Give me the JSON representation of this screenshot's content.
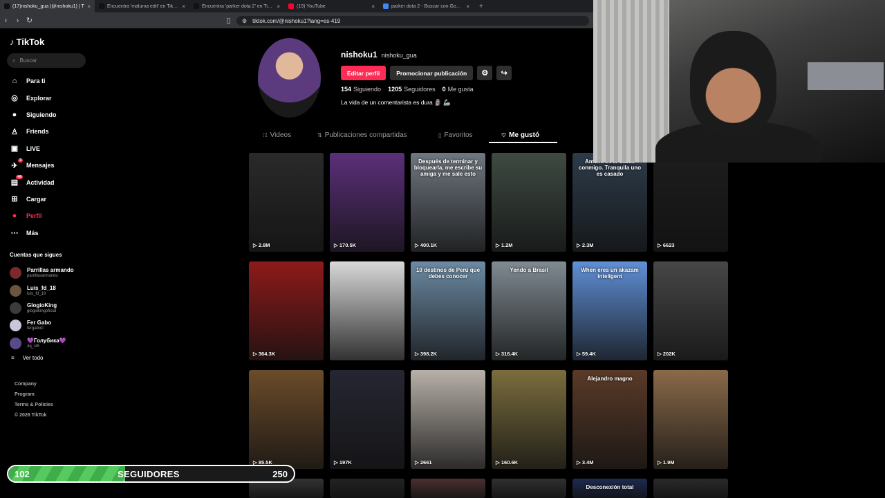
{
  "browser": {
    "tabs": [
      {
        "title": "(17)nishoku_gua (@nishoku1) | T",
        "active": true,
        "favicon_color": "#111111"
      },
      {
        "title": "Encuentra 'maluma edit' en TikTok | I",
        "active": false,
        "favicon_color": "#111111"
      },
      {
        "title": "Encuentra 'parker dota 2' en TikTok | I",
        "active": false,
        "favicon_color": "#111111"
      },
      {
        "title": "(19) YouTube",
        "active": false,
        "favicon_color": "#ff0033"
      },
      {
        "title": "parker dota 2 - Buscar con Google",
        "active": false,
        "favicon_color": "#4285f4"
      }
    ],
    "url": "tiktok.com/@nishoku1?lang=es-419"
  },
  "sidebar": {
    "brand": "TikTok",
    "search_placeholder": "Buscar",
    "nav": [
      {
        "label": "Para ti",
        "icon": "home-icon",
        "glyph": "⌂"
      },
      {
        "label": "Explorar",
        "icon": "compass-icon",
        "glyph": "◎"
      },
      {
        "label": "Siguiendo",
        "icon": "following-icon",
        "glyph": "●"
      },
      {
        "label": "Friends",
        "icon": "friends-icon",
        "glyph": "♙"
      },
      {
        "label": "LIVE",
        "icon": "live-icon",
        "glyph": "▣"
      },
      {
        "label": "Mensajes",
        "icon": "messages-icon",
        "glyph": "✈",
        "badge": "3"
      },
      {
        "label": "Actividad",
        "icon": "activity-icon",
        "glyph": "▤",
        "badge": "44"
      },
      {
        "label": "Cargar",
        "icon": "upload-icon",
        "glyph": "⊞"
      },
      {
        "label": "Perfil",
        "icon": "profile-icon",
        "glyph": "●",
        "active": true
      },
      {
        "label": "Más",
        "icon": "more-icon",
        "glyph": "⋯"
      }
    ],
    "following_heading": "Cuentas que sigues",
    "following": [
      {
        "name": "Parrillas armando",
        "handle": "parrillasarmando",
        "color": "#7a2a2a"
      },
      {
        "name": "Luis_fd_18",
        "handle": "luis_fd_18",
        "color": "#6b5440"
      },
      {
        "name": "GlogioKing",
        "handle": "glogiokingoficial",
        "color": "#3b3b3b"
      },
      {
        "name": "Fer Gabo",
        "handle": "fergabo0",
        "color": "#c7c7d9"
      },
      {
        "name": "💜Голубика💜",
        "handle": "4q_st5",
        "color": "#5a4a8a"
      }
    ],
    "see_all": "Ver todo",
    "footer": [
      "Company",
      "Program",
      "Terms & Policies",
      "© 2026 TikTok"
    ]
  },
  "profile": {
    "username": "nishoku1",
    "nickname": "nishoku_gua",
    "edit_button": "Editar perfil",
    "promote_button": "Promocionar publicación",
    "following_count": "154",
    "following_label": "Siguiendo",
    "followers_count": "1205",
    "followers_label": "Seguidores",
    "likes_count": "0",
    "likes_label": "Me gusta",
    "bio": "La vida de un comentarista es dura 🗿 🦾"
  },
  "tabs": [
    {
      "label": "Videos",
      "icon": "grid-icon",
      "glyph": "⁞⁞⁞"
    },
    {
      "label": "Publicaciones compartidas",
      "icon": "repost-icon",
      "glyph": "⇅"
    },
    {
      "label": "Favoritos",
      "icon": "bookmark-icon",
      "glyph": "▯"
    },
    {
      "label": "Me gustó",
      "icon": "heart-icon",
      "glyph": "♡",
      "active": true
    }
  ],
  "videos": [
    {
      "views": "2.8M",
      "caption": "",
      "bg": "#2a2a2a"
    },
    {
      "views": "170.5K",
      "caption": "",
      "bg": "#5b2f7a"
    },
    {
      "views": "400.1K",
      "caption": "Después de terminar y bloquearla, me escribe su amiga y me sale esto",
      "bg": "#6f7780"
    },
    {
      "views": "1.2M",
      "caption": "",
      "bg": "#3e4a42"
    },
    {
      "views": "2.3M",
      "caption": "Amor... se te casas conmigo. Tranquila uno es casado",
      "bg": "#2d3b4a"
    },
    {
      "views": "6623",
      "caption": "",
      "bg": "#1d1d1d"
    },
    {
      "views": "364.3K",
      "caption": "",
      "bg": "#8e1a1a"
    },
    {
      "views": "",
      "caption": "",
      "bg": "#d8d8d8"
    },
    {
      "views": "398.2K",
      "caption": "10 destinos de Perú que debes conocer",
      "bg": "#6c8aa3"
    },
    {
      "views": "316.4K",
      "caption": "Yendo a Brasil",
      "bg": "#7f8a91"
    },
    {
      "views": "59.4K",
      "caption": "When eres un akazam inteligent",
      "bg": "#5f8fd6"
    },
    {
      "views": "202K",
      "caption": "",
      "bg": "#474747"
    },
    {
      "views": "85.5K",
      "caption": "",
      "bg": "#6b4b2a"
    },
    {
      "views": "197K",
      "caption": "",
      "bg": "#262633"
    },
    {
      "views": "2661",
      "caption": "",
      "bg": "#b7b0a8"
    },
    {
      "views": "160.6K",
      "caption": "",
      "bg": "#7a6d3d"
    },
    {
      "views": "3.4M",
      "caption": "Alejandro magno",
      "bg": "#5a3a28"
    },
    {
      "views": "1.9M",
      "caption": "",
      "bg": "#8a6a48"
    },
    {
      "views": "",
      "caption": "",
      "bg": "#333333"
    },
    {
      "views": "",
      "caption": "",
      "bg": "#222222"
    },
    {
      "views": "",
      "caption": "",
      "bg": "#4a3030"
    },
    {
      "views": "",
      "caption": "",
      "bg": "#303030"
    },
    {
      "views": "",
      "caption": "Desconexión total",
      "bg": "#1e2a50"
    },
    {
      "views": "",
      "caption": "",
      "bg": "#2a2a2a"
    }
  ],
  "follower_bar": {
    "current": "102",
    "label": "SEGUIDORES",
    "goal": "250",
    "progress": 0.408
  },
  "colors": {
    "accent": "#fe2c55",
    "background": "#000000",
    "progress_green": "#3fae4a"
  }
}
